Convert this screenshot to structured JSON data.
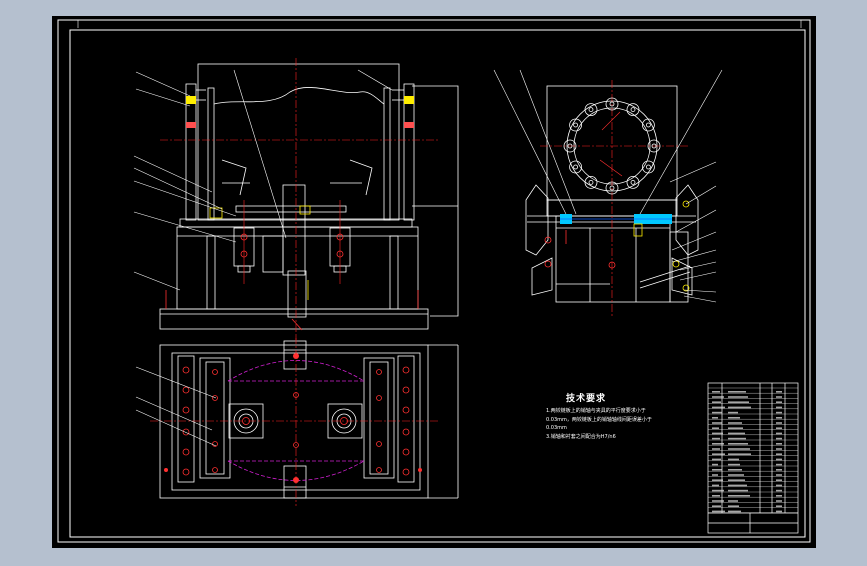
{
  "drawing": {
    "technical_requirements": {
      "title": "技术要求",
      "lines": [
        "1.两铰链板上的销轴与夹具的平行度要求小于",
        "0.03mm，两铰链板上的销轴轴线间距误差小于",
        "0.03mm",
        "3.销轴和衬套之间配合为H7/n6"
      ]
    },
    "colors": {
      "background": "#b5c0cf",
      "sheet": "#000000",
      "outline": "#ffffff",
      "center_line": "#ff2020",
      "dimension": "#ff3030",
      "hidden_line": "#d020d0",
      "highlight": "#00c8ff",
      "bolt": "#ffee00"
    }
  }
}
